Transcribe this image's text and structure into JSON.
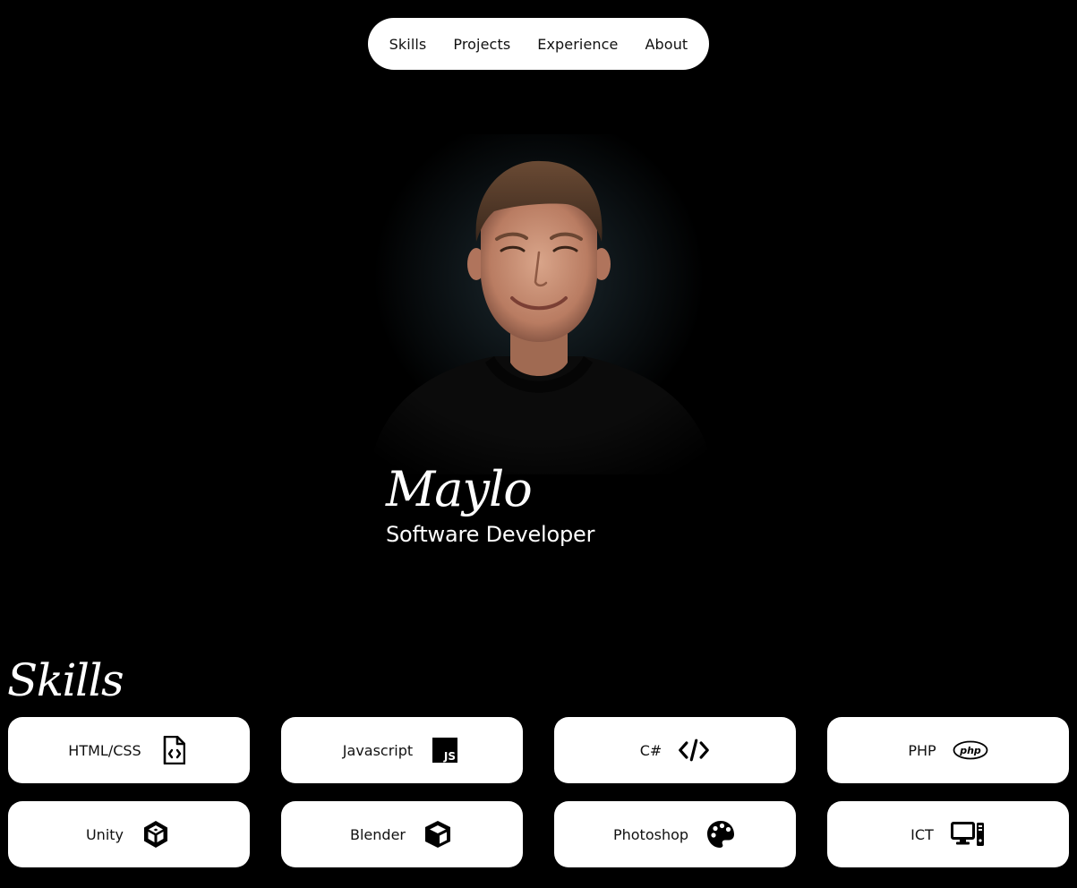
{
  "nav": {
    "items": [
      {
        "label": "Skills"
      },
      {
        "label": "Projects"
      },
      {
        "label": "Experience"
      },
      {
        "label": "About"
      }
    ]
  },
  "hero": {
    "name": "Maylo",
    "role": "Software Developer"
  },
  "skills": {
    "title": "Skills",
    "items": [
      {
        "label": "HTML/CSS",
        "icon": "file-code-icon"
      },
      {
        "label": "Javascript",
        "icon": "javascript-icon"
      },
      {
        "label": "C#",
        "icon": "code-icon"
      },
      {
        "label": "PHP",
        "icon": "php-icon",
        "icon_text": "php"
      },
      {
        "label": "Unity",
        "icon": "unity-icon"
      },
      {
        "label": "Blender",
        "icon": "cube-icon"
      },
      {
        "label": "Photoshop",
        "icon": "palette-icon"
      },
      {
        "label": "ICT",
        "icon": "computer-icon"
      }
    ]
  },
  "colors": {
    "background": "#000000",
    "card": "#ffffff",
    "text_dark": "#111111",
    "text_light": "#ffffff"
  }
}
